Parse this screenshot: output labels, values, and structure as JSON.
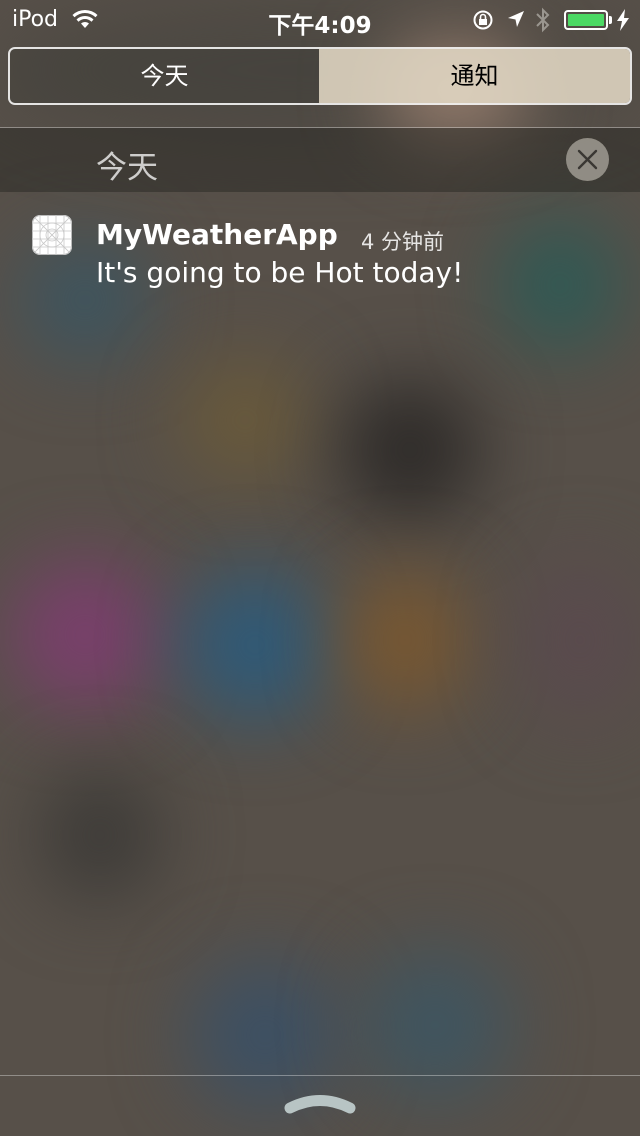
{
  "status_bar": {
    "carrier": "iPod",
    "time": "下午4:09",
    "battery_level": 1.0
  },
  "tabs": {
    "today_label": "今天",
    "notifications_label": "通知"
  },
  "section": {
    "title": "今天"
  },
  "notification": {
    "app_name": "MyWeatherApp",
    "time_ago": "4 分钟前",
    "message": "It's going to be Hot today!"
  },
  "icons": [
    "wifi-icon",
    "orientation-lock-icon",
    "location-arrow-icon",
    "bluetooth-icon",
    "battery-icon",
    "charging-bolt-icon",
    "close-icon",
    "app-placeholder-icon",
    "chevron-up-icon"
  ],
  "colors": {
    "battery_fill": "#4cd964",
    "selected_tab_bg": "#e6dcc8"
  }
}
